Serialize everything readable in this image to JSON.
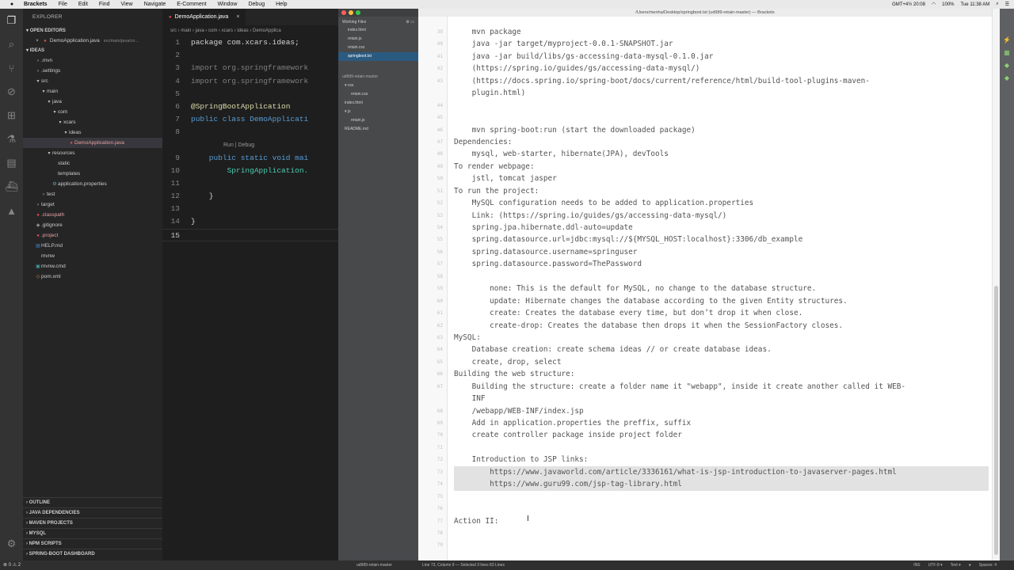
{
  "menubar": {
    "app": "Brackets",
    "items": [
      "File",
      "Edit",
      "Find",
      "View",
      "Navigate",
      "E-Comment",
      "Window",
      "Debug",
      "Help"
    ],
    "clock": "Tue 11:38 AM",
    "weather": "GMT+4½ 20:08",
    "battery": "100%"
  },
  "vscode": {
    "sidebar": {
      "title": "EXPLORER",
      "open_editors_label": "OPEN EDITORS",
      "open_file": "DemoApplication.java",
      "open_file_path": "src/main/java/co...",
      "project_label": "IDEAS",
      "tree": [
        {
          "label": ".mvn",
          "depth": 1,
          "kind": "folder-closed"
        },
        {
          "label": ".settings",
          "depth": 1,
          "kind": "folder-closed"
        },
        {
          "label": "src",
          "depth": 1,
          "kind": "folder-open"
        },
        {
          "label": "main",
          "depth": 2,
          "kind": "folder-open"
        },
        {
          "label": "java",
          "depth": 3,
          "kind": "folder-open"
        },
        {
          "label": "com",
          "depth": 4,
          "kind": "folder-open"
        },
        {
          "label": "xcars",
          "depth": 5,
          "kind": "folder-open"
        },
        {
          "label": "ideas",
          "depth": 6,
          "kind": "folder-open"
        },
        {
          "label": "DemoApplication.java",
          "depth": 7,
          "kind": "java",
          "selected": true
        },
        {
          "label": "resources",
          "depth": 3,
          "kind": "folder-open"
        },
        {
          "label": "static",
          "depth": 4,
          "kind": "file"
        },
        {
          "label": "templates",
          "depth": 4,
          "kind": "file"
        },
        {
          "label": "application.properties",
          "depth": 4,
          "kind": "props"
        },
        {
          "label": "test",
          "depth": 2,
          "kind": "folder-closed"
        },
        {
          "label": "target",
          "depth": 1,
          "kind": "folder-closed"
        },
        {
          "label": ".classpath",
          "depth": 1,
          "kind": "red"
        },
        {
          "label": ".gitignore",
          "depth": 1,
          "kind": "git"
        },
        {
          "label": ".project",
          "depth": 1,
          "kind": "red"
        },
        {
          "label": "HELP.md",
          "depth": 1,
          "kind": "md"
        },
        {
          "label": "mvnw",
          "depth": 1,
          "kind": "file"
        },
        {
          "label": "mvnw.cmd",
          "depth": 1,
          "kind": "cmd"
        },
        {
          "label": "pom.xml",
          "depth": 1,
          "kind": "xml"
        }
      ],
      "bottom_sections": [
        "OUTLINE",
        "JAVA DEPENDENCIES",
        "MAVEN PROJECTS",
        "MYSQL",
        "NPM SCRIPTS",
        "SPRING-BOOT DASHBOARD"
      ]
    },
    "tab": {
      "label": "DemoApplication.java"
    },
    "breadcrumb": "src › main › java › com › xcars › ideas › DemoApplica",
    "code_lines": [
      {
        "n": "1",
        "text": "package com.xcars.ideas;"
      },
      {
        "n": "2",
        "text": ""
      },
      {
        "n": "3",
        "text": "import org.springframework"
      },
      {
        "n": "4",
        "text": "import org.springframework"
      },
      {
        "n": "5",
        "text": ""
      },
      {
        "n": "6",
        "text": "@SpringBootApplication"
      },
      {
        "n": "7",
        "text": "public class DemoApplicati"
      },
      {
        "n": "8",
        "text": ""
      },
      {
        "n": "9",
        "text": "    public static void mai"
      },
      {
        "n": "10",
        "text": "        SpringApplication."
      },
      {
        "n": "11",
        "text": ""
      },
      {
        "n": "12",
        "text": "    }"
      },
      {
        "n": "13",
        "text": ""
      },
      {
        "n": "14",
        "text": "}"
      },
      {
        "n": "15",
        "text": ""
      }
    ],
    "codelens": "Run | Debug",
    "status_left": "⊗ 0 ⚠ 2"
  },
  "brackets": {
    "title": "/Users/menha/Desktop/springboot.txt (ud989-retain-master) — Brackets",
    "working_files_label": "Working Files",
    "working_files": [
      "index.html",
      "retain.js",
      "retain.css",
      "springboot.txt"
    ],
    "active_working_file": "springboot.txt",
    "project_label": "ud989-retain-master",
    "project_tree": [
      {
        "label": "▾ css",
        "depth": 0
      },
      {
        "label": "retain.css",
        "depth": 1
      },
      {
        "label": "index.html",
        "depth": 0
      },
      {
        "label": "▾ js",
        "depth": 0
      },
      {
        "label": "retain.js",
        "depth": 1
      },
      {
        "label": "README.md",
        "depth": 0
      }
    ],
    "lines": [
      {
        "n": "39",
        "text": "    mvn package"
      },
      {
        "n": "40",
        "text": "    java -jar target/myproject-0.0.1-SNAPSHOT.jar"
      },
      {
        "n": "41",
        "text": "    java -jar build/libs/gs-accessing-data-mysql-0.1.0.jar"
      },
      {
        "n": "42",
        "text": "    (https://spring.io/guides/gs/accessing-data-mysql/)"
      },
      {
        "n": "43",
        "text": "    (https://docs.spring.io/spring-boot/docs/current/reference/html/build-tool-plugins-maven-"
      },
      {
        "n": "",
        "text": "    plugin.html)"
      },
      {
        "n": "44",
        "text": ""
      },
      {
        "n": "45",
        "text": ""
      },
      {
        "n": "46",
        "text": "    mvn spring-boot:run (start the downloaded package)"
      },
      {
        "n": "47",
        "text": "Dependencies:"
      },
      {
        "n": "48",
        "text": "    mysql, web-starter, hibernate(JPA), devTools"
      },
      {
        "n": "49",
        "text": "To render webpage:"
      },
      {
        "n": "50",
        "text": "    jstl, tomcat jasper"
      },
      {
        "n": "51",
        "text": "To run the project:"
      },
      {
        "n": "52",
        "text": "    MySQL configuration needs to be added to application.properties"
      },
      {
        "n": "53",
        "text": "    Link: (https://spring.io/guides/gs/accessing-data-mysql/)"
      },
      {
        "n": "54",
        "text": "    spring.jpa.hibernate.ddl-auto=update"
      },
      {
        "n": "55",
        "text": "    spring.datasource.url=jdbc:mysql://${MYSQL_HOST:localhost}:3306/db_example"
      },
      {
        "n": "56",
        "text": "    spring.datasource.username=springuser"
      },
      {
        "n": "57",
        "text": "    spring.datasource.password=ThePassword"
      },
      {
        "n": "58",
        "text": ""
      },
      {
        "n": "59",
        "text": "        none: This is the default for MySQL, no change to the database structure."
      },
      {
        "n": "60",
        "text": "        update: Hibernate changes the database according to the given Entity structures."
      },
      {
        "n": "61",
        "text": "        create: Creates the database every time, but don’t drop it when close."
      },
      {
        "n": "62",
        "text": "        create-drop: Creates the database then drops it when the SessionFactory closes."
      },
      {
        "n": "63",
        "text": "MySQL:"
      },
      {
        "n": "64",
        "text": "    Database creation: create schema ideas // or create database ideas."
      },
      {
        "n": "65",
        "text": "    create, drop, select"
      },
      {
        "n": "66",
        "text": "Building the web structure:"
      },
      {
        "n": "67",
        "text": "    Building the structure: create a folder name it \"webapp\", inside it create another called it WEB-"
      },
      {
        "n": "",
        "text": "    INF"
      },
      {
        "n": "68",
        "text": "    /webapp/WEB-INF/index.jsp"
      },
      {
        "n": "69",
        "text": "    Add in application.properties the preffix, suffix"
      },
      {
        "n": "70",
        "text": "    create controller package inside project folder"
      },
      {
        "n": "71",
        "text": ""
      },
      {
        "n": "72",
        "text": "    Introduction to JSP links:"
      },
      {
        "n": "73",
        "text": "        https://www.javaworld.com/article/3336161/what-is-jsp-introduction-to-javaserver-pages.html",
        "sel": true
      },
      {
        "n": "74",
        "text": "        https://www.guru99.com/jsp-tag-library.html",
        "sel": true
      },
      {
        "n": "75",
        "text": "",
        "sel": true
      },
      {
        "n": "76",
        "text": ""
      },
      {
        "n": "77",
        "text": "Action II:"
      },
      {
        "n": "78",
        "text": ""
      },
      {
        "n": "79",
        "text": ""
      }
    ],
    "status_project": "ud989-retain-master",
    "status_cursor": "Line 73, Column 9 — Selected 3 lines  83 Lines",
    "status_right": [
      "INS",
      "UTF-8 ▾",
      "Text ▾",
      "●",
      "Spaces: 4"
    ]
  },
  "colors": {
    "vscode_bg": "#1e1e1e",
    "vscode_sidebar": "#252526",
    "brackets_sidebar": "#47494b",
    "selection": "#e4e4e4",
    "active_file": "#2b5a80"
  }
}
